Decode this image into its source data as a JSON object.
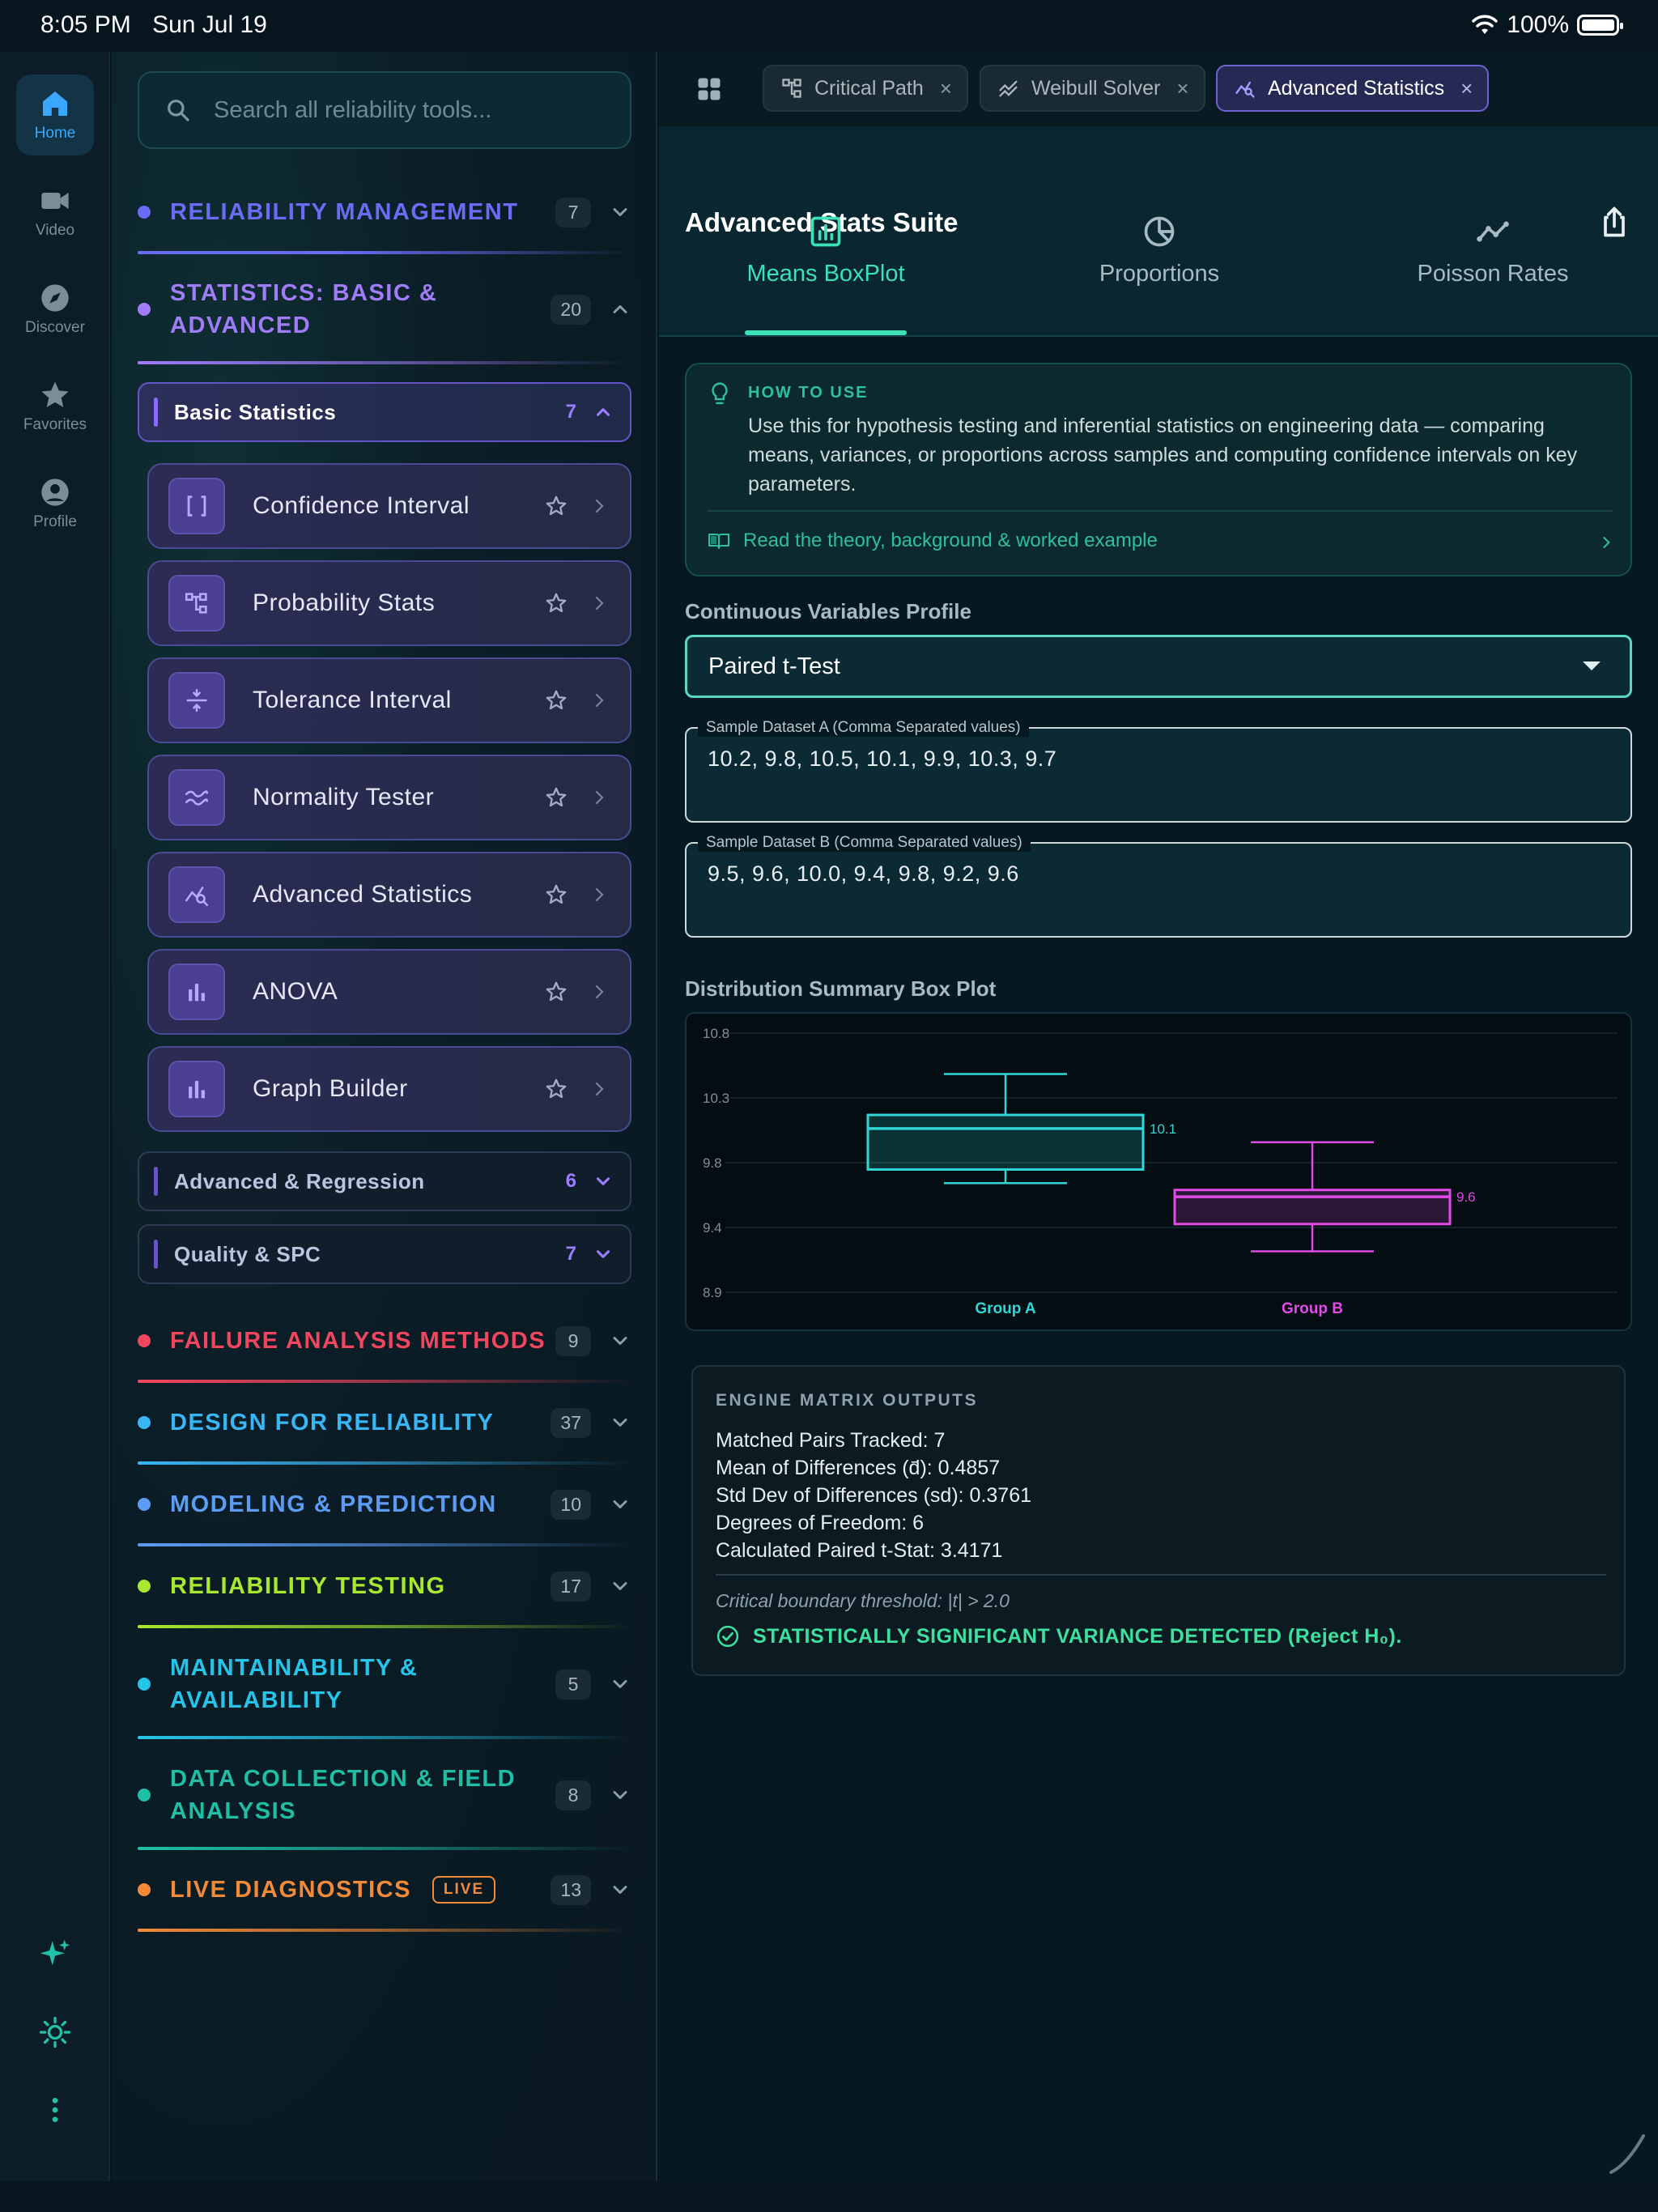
{
  "status": {
    "time": "8:05 PM",
    "date": "Sun Jul 19",
    "battery": "100%"
  },
  "rail": {
    "items": [
      {
        "label": "Home",
        "icon": "home-icon"
      },
      {
        "label": "Video",
        "icon": "video-icon"
      },
      {
        "label": "Discover",
        "icon": "compass-icon"
      },
      {
        "label": "Favorites",
        "icon": "star-icon"
      },
      {
        "label": "Profile",
        "icon": "profile-icon"
      }
    ],
    "bottom_icons": [
      "sparkle-icon",
      "sun-icon",
      "more-vertical-icon"
    ]
  },
  "sidebar": {
    "search_placeholder": "Search all reliability tools...",
    "categories": [
      {
        "title": "RELIABILITY MANAGEMENT",
        "count": "7",
        "color": "#6b6cf6"
      },
      {
        "title_line1": "STATISTICS: BASIC &",
        "title_line2": "ADVANCED",
        "count": "20",
        "color": "#a07cf8"
      },
      {
        "title": "FAILURE ANALYSIS METHODS",
        "count": "9",
        "color": "#f2465f"
      },
      {
        "title": "DESIGN FOR RELIABILITY",
        "count": "37",
        "color": "#38b6f5"
      },
      {
        "title": "MODELING & PREDICTION",
        "count": "10",
        "color": "#5d9cf4"
      },
      {
        "title": "RELIABILITY TESTING",
        "count": "17",
        "color": "#a8e830"
      },
      {
        "title_line1": "MAINTAINABILITY &",
        "title_line2": "AVAILABILITY",
        "count": "5",
        "color": "#27c4ea"
      },
      {
        "title_line1": "DATA COLLECTION & FIELD",
        "title_line2": "ANALYSIS",
        "count": "8",
        "color": "#1fbfa6"
      },
      {
        "title": "LIVE DIAGNOSTICS",
        "badge": "LIVE",
        "count": "13",
        "color": "#f28a3a"
      }
    ],
    "subgroups": [
      {
        "label": "Basic Statistics",
        "count": "7"
      },
      {
        "label": "Advanced & Regression",
        "count": "6"
      },
      {
        "label": "Quality & SPC",
        "count": "7"
      }
    ],
    "tools": [
      {
        "name": "Confidence Interval",
        "icon": "brackets-icon"
      },
      {
        "name": "Probability Stats",
        "icon": "tree-icon"
      },
      {
        "name": "Tolerance Interval",
        "icon": "tolerance-icon"
      },
      {
        "name": "Normality Tester",
        "icon": "wave-icon"
      },
      {
        "name": "Advanced Statistics",
        "icon": "analytics-icon"
      },
      {
        "name": "ANOVA",
        "icon": "bar-chart-icon"
      },
      {
        "name": "Graph Builder",
        "icon": "bar-chart-icon"
      }
    ]
  },
  "tabs": [
    {
      "label": "Critical Path",
      "icon": "network-icon"
    },
    {
      "label": "Weibull Solver",
      "icon": "trend-icon"
    },
    {
      "label": "Advanced Statistics",
      "icon": "analytics-icon",
      "active": true
    }
  ],
  "header": {
    "title": "Advanced Stats Suite",
    "segments": [
      "Means BoxPlot",
      "Proportions",
      "Poisson Rates"
    ]
  },
  "howto": {
    "heading": "HOW TO USE",
    "body": "Use this for hypothesis testing and inferential statistics on engineering data — comparing means, variances, or proportions across samples and computing confidence intervals on key parameters.",
    "link": "Read the theory, background & worked example"
  },
  "form": {
    "profile_label": "Continuous Variables Profile",
    "profile_value": "Paired t-Test",
    "dataset_a_label": "Sample Dataset A (Comma Separated values)",
    "dataset_a_value": "10.2, 9.8, 10.5, 10.1, 9.9, 10.3, 9.7",
    "dataset_b_label": "Sample Dataset B (Comma Separated values)",
    "dataset_b_value": "9.5, 9.6, 10.0, 9.4, 9.8, 9.2, 9.6"
  },
  "chart_label": "Distribution Summary Box Plot",
  "chart_data": {
    "type": "box",
    "title": "Distribution Summary Box Plot",
    "yticks": [
      "10.8",
      "10.3",
      "9.8",
      "9.4",
      "8.9"
    ],
    "ylim": [
      8.9,
      10.8
    ],
    "grid": true,
    "series": [
      {
        "name": "Group A",
        "min": 9.7,
        "q1": 9.8,
        "median": 10.1,
        "q3": 10.2,
        "max": 10.5,
        "label": "10.1",
        "color": "#2fd7d7"
      },
      {
        "name": "Group B",
        "min": 9.2,
        "q1": 9.4,
        "median": 9.6,
        "q3": 9.65,
        "max": 10.0,
        "label": "9.6",
        "color": "#e04be6"
      }
    ]
  },
  "outputs": {
    "heading": "ENGINE MATRIX OUTPUTS",
    "lines": [
      "Matched Pairs Tracked: 7",
      "Mean of Differences (d̄): 0.4857",
      "Std Dev of Differences (sd): 0.3761",
      "Degrees of Freedom: 6",
      "Calculated Paired t-Stat: 3.4171"
    ],
    "critical": "Critical boundary threshold: |t| > 2.0",
    "result": "STATISTICALLY SIGNIFICANT VARIANCE DETECTED (Reject H₀)."
  }
}
